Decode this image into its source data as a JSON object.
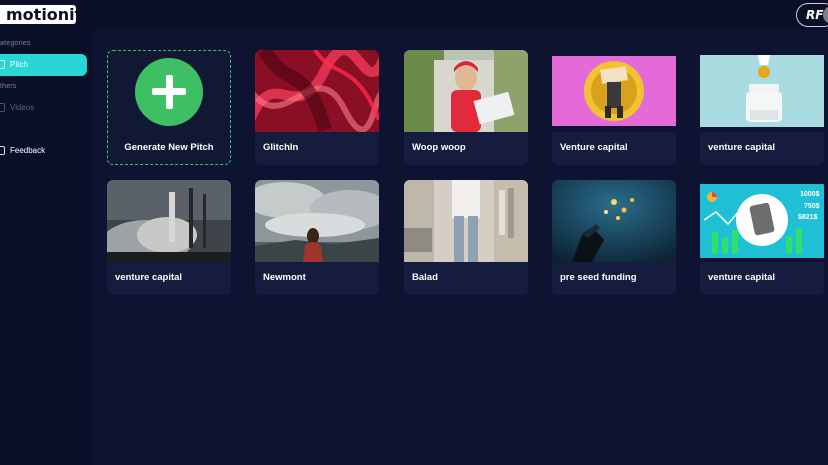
{
  "app": {
    "logo_text": "motionit",
    "user_initials": "RF"
  },
  "sidebar": {
    "sections": [
      {
        "title": "ategories",
        "items": [
          {
            "label": "Pitch",
            "active": true
          }
        ]
      },
      {
        "title": "thers",
        "items": [
          {
            "label": "Videos",
            "active": false,
            "disabled": true
          }
        ]
      }
    ],
    "feedback_label": "Feedback"
  },
  "colors": {
    "background": "#0d1330",
    "sidebar": "#0b1029",
    "card": "#161c3e",
    "accent": "#2ad5d5",
    "create_green": "#3fbf63"
  },
  "cards": [
    {
      "title": "Generate New Pitch",
      "icon": "plus-circle-icon"
    },
    {
      "title": "GlitchIn",
      "thumb": "red glitch pattern"
    },
    {
      "title": "Woop woop",
      "thumb": "woman with clipboard"
    },
    {
      "title": "Venture capital",
      "thumb": "coin loss illustration"
    },
    {
      "title": "venture capital",
      "thumb": "coin jar illustration"
    },
    {
      "title": "venture capital",
      "thumb": "rocket launch photo"
    },
    {
      "title": "Newmont",
      "thumb": "person under cloudy sky"
    },
    {
      "title": "Balad",
      "thumb": "person in clothing store"
    },
    {
      "title": "pre seed funding",
      "thumb": "robot hand with coins"
    },
    {
      "title": "venture capital",
      "thumb": "growth chart illustration",
      "figures": [
        "1000$",
        "750$",
        "$821$"
      ]
    }
  ]
}
